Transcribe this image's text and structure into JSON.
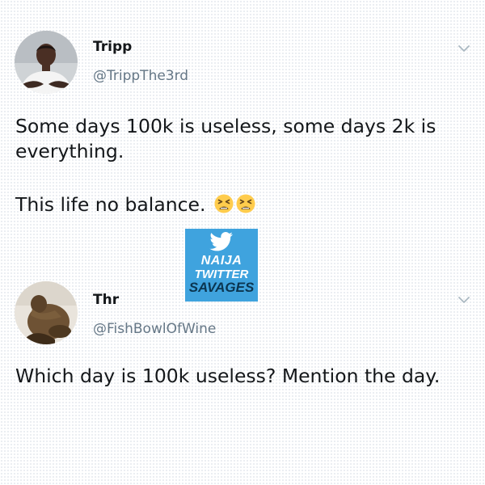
{
  "tweets": [
    {
      "display_name": "Tripp",
      "handle": "@TrippThe3rd",
      "text_lines": [
        "Some days 100k is useless, some days 2k is",
        "everything.",
        "This life no balance."
      ],
      "emojis": [
        "tired-face-emoji",
        "tired-face-emoji"
      ],
      "menu_icon": "chevron-down-icon"
    },
    {
      "display_name": "Thr",
      "handle": "@FishBowlOfWine",
      "text_lines": [
        "Which day is 100k useless? Mention the day."
      ],
      "menu_icon": "chevron-down-icon"
    }
  ],
  "watermark": {
    "icon": "twitter-bird-icon",
    "lines": [
      "NAIJA",
      "TWITTER",
      "SAVAGES"
    ],
    "background": "#3fa3de"
  },
  "colors": {
    "text": "#14171a",
    "secondary_text": "#657786",
    "chevron": "#aab8c2",
    "emoji": "#ffcc4d"
  }
}
